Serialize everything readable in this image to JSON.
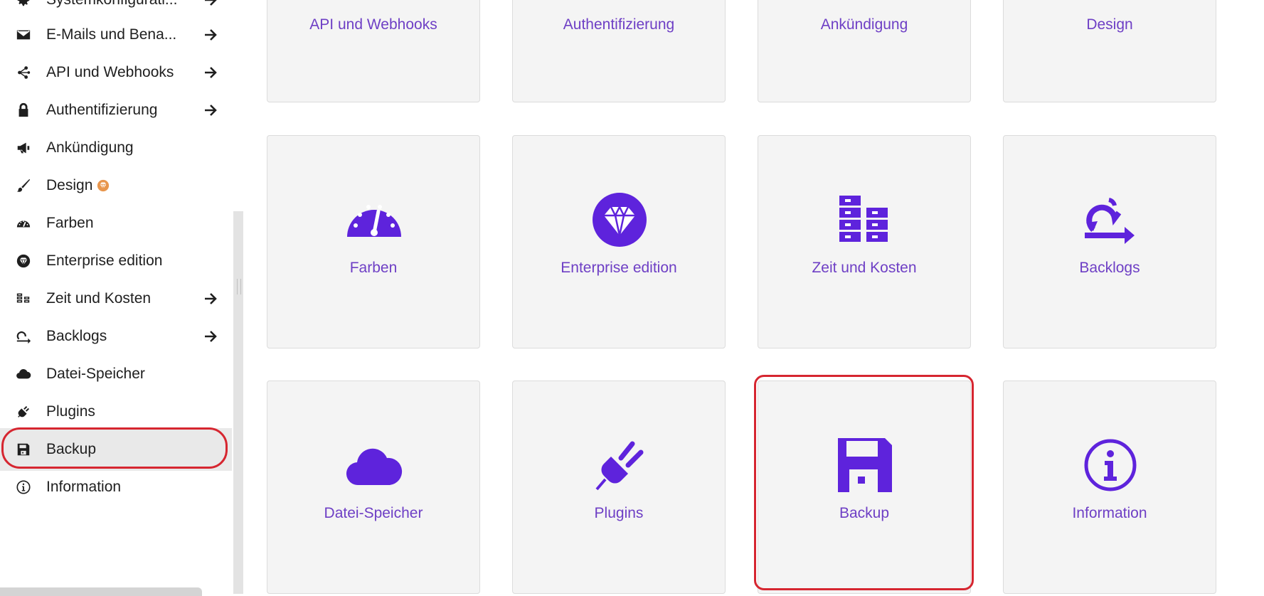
{
  "sidebar": {
    "items": [
      {
        "label": "Systemkonfigurati...",
        "icon": "gear-icon",
        "has_arrow": true
      },
      {
        "label": "E-Mails und Bena...",
        "icon": "envelope-icon",
        "has_arrow": true
      },
      {
        "label": "API und Webhooks",
        "icon": "share-nodes-icon",
        "has_arrow": true
      },
      {
        "label": "Authentifizierung",
        "icon": "lock-icon",
        "has_arrow": true
      },
      {
        "label": "Ankündigung",
        "icon": "megaphone-icon",
        "has_arrow": false
      },
      {
        "label": "Design",
        "icon": "brush-icon",
        "has_arrow": false,
        "badge": "enterprise-badge-icon"
      },
      {
        "label": "Farben",
        "icon": "gauge-icon",
        "has_arrow": false
      },
      {
        "label": "Enterprise edition",
        "icon": "diamond-icon",
        "has_arrow": false
      },
      {
        "label": "Zeit und Kosten",
        "icon": "coins-icon",
        "has_arrow": true
      },
      {
        "label": "Backlogs",
        "icon": "backlog-arrow-icon",
        "has_arrow": true
      },
      {
        "label": "Datei-Speicher",
        "icon": "cloud-icon",
        "has_arrow": false
      },
      {
        "label": "Plugins",
        "icon": "plug-icon",
        "has_arrow": false
      },
      {
        "label": "Backup",
        "icon": "floppy-disk-icon",
        "has_arrow": false,
        "selected": true
      },
      {
        "label": "Information",
        "icon": "info-icon",
        "has_arrow": false
      }
    ]
  },
  "tiles": {
    "row1": [
      "API und Webhooks",
      "Authentifizierung",
      "Ankündigung",
      "Design"
    ],
    "row2": [
      {
        "label": "Farben",
        "icon": "gauge-icon"
      },
      {
        "label": "Enterprise edition",
        "icon": "diamond-icon"
      },
      {
        "label": "Zeit und Kosten",
        "icon": "coins-icon"
      },
      {
        "label": "Backlogs",
        "icon": "backlog-arrow-icon"
      }
    ],
    "row3": [
      {
        "label": "Datei-Speicher",
        "icon": "cloud-icon"
      },
      {
        "label": "Plugins",
        "icon": "plug-icon"
      },
      {
        "label": "Backup",
        "icon": "floppy-disk-icon",
        "highlighted": true
      },
      {
        "label": "Information",
        "icon": "info-icon"
      }
    ]
  },
  "colors": {
    "accent": "#5e23dc",
    "tile_label": "#6e3fc5",
    "highlight": "#d62630",
    "tile_bg": "#f4f4f4",
    "badge": "#e8964d"
  }
}
